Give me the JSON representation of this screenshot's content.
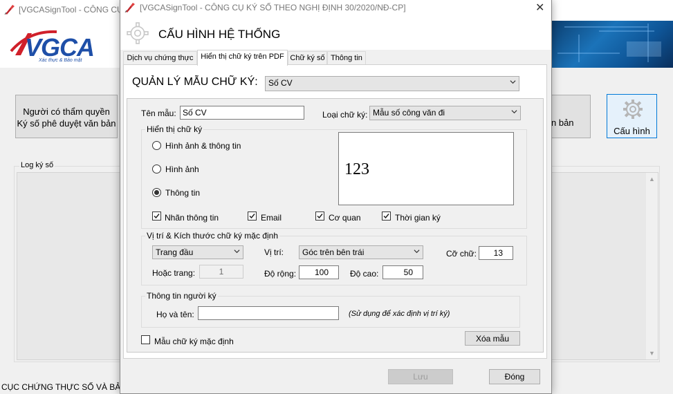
{
  "main_window": {
    "title": "[VGCASignTool - CÔNG CỤ",
    "logo_text": "VGCA",
    "logo_subtext": "Xác thực & Bảo mật",
    "left_button": {
      "line1": "Người có thẩm quyền",
      "line2": "Ký số phê duyệt văn bản"
    },
    "right_partial_button_label": "n bản",
    "config_button_label": "Cấu hình",
    "log_group_label": "Log ký số",
    "footer_text": "CỤC CHỨNG THỰC SỐ VÀ BẢO M"
  },
  "dialog": {
    "title": "[VGCASignTool - CÔNG CỤ KÝ SỐ THEO NGHỊ ĐỊNH 30/2020/NĐ-CP]",
    "heading": "CẤU HÌNH HỆ THỐNG",
    "tabs": [
      {
        "label": "Dịch vụ chứng thực",
        "active": false
      },
      {
        "label": "Hiển thị chữ ký trên PDF",
        "active": true
      },
      {
        "label": "Chữ ký số",
        "active": false
      },
      {
        "label": "Thông tin",
        "active": false
      }
    ],
    "template_manager": {
      "label": "QUẢN LÝ MẪU CHỮ KÝ:",
      "selected": "Số CV"
    },
    "template_name": {
      "label": "Tên mẫu:",
      "value": "Số CV"
    },
    "signature_type": {
      "label": "Loại chữ ký:",
      "selected": "Mẫu số công văn đi"
    },
    "display_group": {
      "label": "Hiển thị chữ ký",
      "radios": [
        {
          "label": "Hình ảnh & thông tin",
          "checked": false
        },
        {
          "label": "Hình ảnh",
          "checked": false
        },
        {
          "label": "Thông tin",
          "checked": true
        }
      ],
      "preview_text": "123",
      "checkboxes": [
        {
          "label": "Nhãn thông tin",
          "checked": true
        },
        {
          "label": "Email",
          "checked": true
        },
        {
          "label": "Cơ quan",
          "checked": true
        },
        {
          "label": "Thời gian ký",
          "checked": true
        }
      ]
    },
    "position_group": {
      "label": "Vị trí  & Kích thước chữ ký mặc định",
      "page_selected": "Trang đầu",
      "or_page_label": "Hoặc trang:",
      "or_page_value": "1",
      "position_label": "Vị trí:",
      "position_selected": "Góc trên bên trái",
      "font_size_label": "Cỡ chữ:",
      "font_size_value": "13",
      "width_label": "Độ rộng:",
      "width_value": "100",
      "height_label": "Độ cao:",
      "height_value": "50"
    },
    "signer_group": {
      "label": "Thông tin người ký",
      "name_label": "Họ và tên:",
      "name_value": "",
      "hint": "(Sử dụng để xác định vị trí ký)"
    },
    "default_template": {
      "label": "Mẫu chữ ký mặc định",
      "checked": false
    },
    "delete_button": "Xóa mẫu",
    "save_button": "Lưu",
    "close_button": "Đóng"
  },
  "colors": {
    "accent": "#0078d7",
    "logo_blue": "#1e4fa8",
    "logo_red": "#d0202a"
  }
}
